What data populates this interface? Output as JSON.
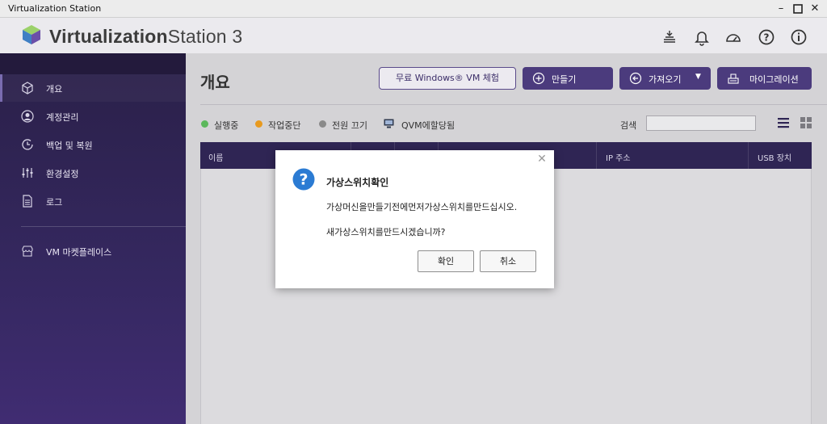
{
  "window": {
    "title": "Virtualization Station",
    "controls": [
      "minimize-icon",
      "maximize-icon",
      "close-icon"
    ]
  },
  "header": {
    "app_name_bold": "Virtualization",
    "app_name_rest": "Station 3",
    "icons": [
      "task-stack-icon",
      "bell-icon",
      "dashboard-gauge-icon",
      "help-icon",
      "info-icon"
    ]
  },
  "sidebar": {
    "items": [
      {
        "label": "개요",
        "icon": "cube-icon",
        "active": true
      },
      {
        "label": "계정관리",
        "icon": "user-circle-icon"
      },
      {
        "label": "백업 및 복원",
        "icon": "backup-clock-icon"
      },
      {
        "label": "환경설정",
        "icon": "sliders-icon"
      },
      {
        "label": "로그",
        "icon": "document-icon"
      }
    ],
    "market": {
      "label": "VM 마켓플레이스",
      "icon": "store-icon"
    }
  },
  "main": {
    "title": "개요",
    "buttons": {
      "trial": "무료 Windows® VM 체험",
      "create": "만들기",
      "import": "가져오기",
      "migrate": "마이그레이션"
    },
    "legend": [
      {
        "label": "실행중",
        "color": "#5cb85c"
      },
      {
        "label": "작업중단",
        "color": "#e89a1f"
      },
      {
        "label": "전원 끄기",
        "color": "#8a8a8a"
      },
      {
        "label": "QVM에할당됨",
        "color": "#2f3a4f"
      }
    ],
    "search_label": "검색",
    "search_value": "",
    "table_columns": [
      "이름",
      "IP 주소",
      "USB 장치"
    ]
  },
  "dialog": {
    "title": "가상스위치확인",
    "message1": "가상머신을만들기전에먼저가상스위치를만드십시오.",
    "message2": "새가상스위치를만드시겠습니까?",
    "ok": "확인",
    "cancel": "취소"
  },
  "colors": {
    "sidebar": "#352860",
    "accent": "#4b3b7d",
    "question_blue": "#2b7bd3"
  }
}
